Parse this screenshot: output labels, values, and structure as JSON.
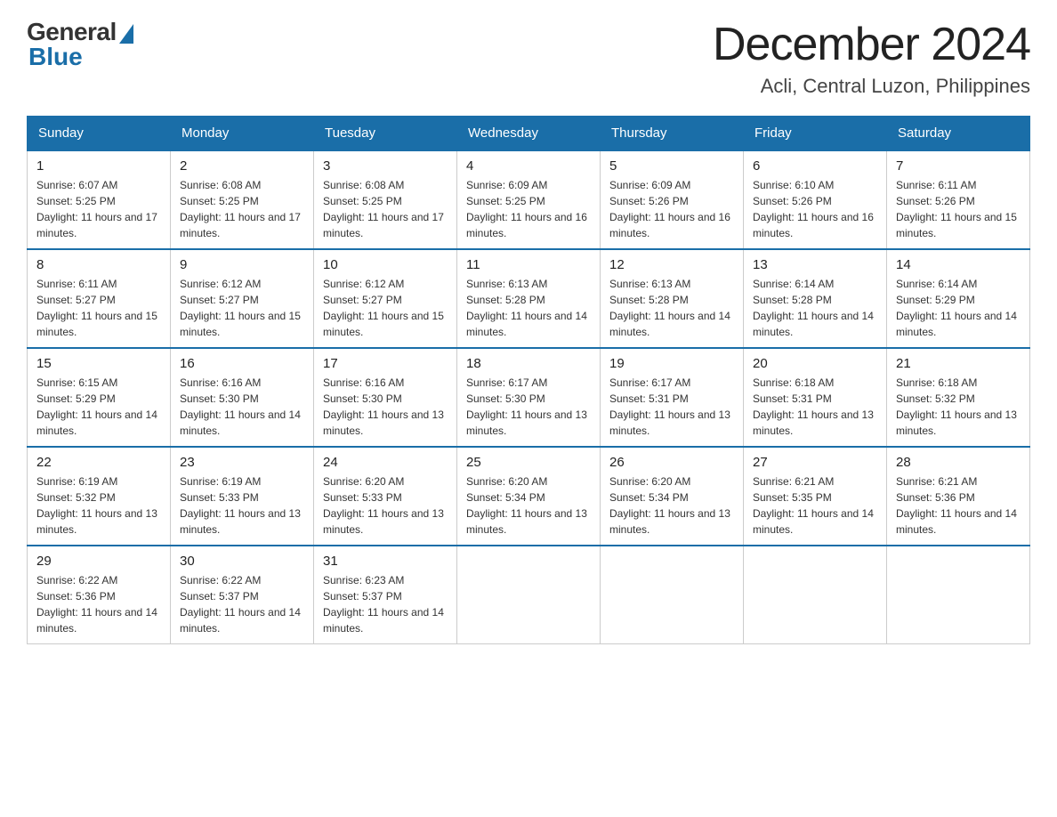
{
  "header": {
    "logo_general": "General",
    "logo_blue": "Blue",
    "month_title": "December 2024",
    "location": "Acli, Central Luzon, Philippines"
  },
  "days_of_week": [
    "Sunday",
    "Monday",
    "Tuesday",
    "Wednesday",
    "Thursday",
    "Friday",
    "Saturday"
  ],
  "weeks": [
    [
      {
        "day": "1",
        "sunrise": "6:07 AM",
        "sunset": "5:25 PM",
        "daylight": "11 hours and 17 minutes."
      },
      {
        "day": "2",
        "sunrise": "6:08 AM",
        "sunset": "5:25 PM",
        "daylight": "11 hours and 17 minutes."
      },
      {
        "day": "3",
        "sunrise": "6:08 AM",
        "sunset": "5:25 PM",
        "daylight": "11 hours and 17 minutes."
      },
      {
        "day": "4",
        "sunrise": "6:09 AM",
        "sunset": "5:25 PM",
        "daylight": "11 hours and 16 minutes."
      },
      {
        "day": "5",
        "sunrise": "6:09 AM",
        "sunset": "5:26 PM",
        "daylight": "11 hours and 16 minutes."
      },
      {
        "day": "6",
        "sunrise": "6:10 AM",
        "sunset": "5:26 PM",
        "daylight": "11 hours and 16 minutes."
      },
      {
        "day": "7",
        "sunrise": "6:11 AM",
        "sunset": "5:26 PM",
        "daylight": "11 hours and 15 minutes."
      }
    ],
    [
      {
        "day": "8",
        "sunrise": "6:11 AM",
        "sunset": "5:27 PM",
        "daylight": "11 hours and 15 minutes."
      },
      {
        "day": "9",
        "sunrise": "6:12 AM",
        "sunset": "5:27 PM",
        "daylight": "11 hours and 15 minutes."
      },
      {
        "day": "10",
        "sunrise": "6:12 AM",
        "sunset": "5:27 PM",
        "daylight": "11 hours and 15 minutes."
      },
      {
        "day": "11",
        "sunrise": "6:13 AM",
        "sunset": "5:28 PM",
        "daylight": "11 hours and 14 minutes."
      },
      {
        "day": "12",
        "sunrise": "6:13 AM",
        "sunset": "5:28 PM",
        "daylight": "11 hours and 14 minutes."
      },
      {
        "day": "13",
        "sunrise": "6:14 AM",
        "sunset": "5:28 PM",
        "daylight": "11 hours and 14 minutes."
      },
      {
        "day": "14",
        "sunrise": "6:14 AM",
        "sunset": "5:29 PM",
        "daylight": "11 hours and 14 minutes."
      }
    ],
    [
      {
        "day": "15",
        "sunrise": "6:15 AM",
        "sunset": "5:29 PM",
        "daylight": "11 hours and 14 minutes."
      },
      {
        "day": "16",
        "sunrise": "6:16 AM",
        "sunset": "5:30 PM",
        "daylight": "11 hours and 14 minutes."
      },
      {
        "day": "17",
        "sunrise": "6:16 AM",
        "sunset": "5:30 PM",
        "daylight": "11 hours and 13 minutes."
      },
      {
        "day": "18",
        "sunrise": "6:17 AM",
        "sunset": "5:30 PM",
        "daylight": "11 hours and 13 minutes."
      },
      {
        "day": "19",
        "sunrise": "6:17 AM",
        "sunset": "5:31 PM",
        "daylight": "11 hours and 13 minutes."
      },
      {
        "day": "20",
        "sunrise": "6:18 AM",
        "sunset": "5:31 PM",
        "daylight": "11 hours and 13 minutes."
      },
      {
        "day": "21",
        "sunrise": "6:18 AM",
        "sunset": "5:32 PM",
        "daylight": "11 hours and 13 minutes."
      }
    ],
    [
      {
        "day": "22",
        "sunrise": "6:19 AM",
        "sunset": "5:32 PM",
        "daylight": "11 hours and 13 minutes."
      },
      {
        "day": "23",
        "sunrise": "6:19 AM",
        "sunset": "5:33 PM",
        "daylight": "11 hours and 13 minutes."
      },
      {
        "day": "24",
        "sunrise": "6:20 AM",
        "sunset": "5:33 PM",
        "daylight": "11 hours and 13 minutes."
      },
      {
        "day": "25",
        "sunrise": "6:20 AM",
        "sunset": "5:34 PM",
        "daylight": "11 hours and 13 minutes."
      },
      {
        "day": "26",
        "sunrise": "6:20 AM",
        "sunset": "5:34 PM",
        "daylight": "11 hours and 13 minutes."
      },
      {
        "day": "27",
        "sunrise": "6:21 AM",
        "sunset": "5:35 PM",
        "daylight": "11 hours and 14 minutes."
      },
      {
        "day": "28",
        "sunrise": "6:21 AM",
        "sunset": "5:36 PM",
        "daylight": "11 hours and 14 minutes."
      }
    ],
    [
      {
        "day": "29",
        "sunrise": "6:22 AM",
        "sunset": "5:36 PM",
        "daylight": "11 hours and 14 minutes."
      },
      {
        "day": "30",
        "sunrise": "6:22 AM",
        "sunset": "5:37 PM",
        "daylight": "11 hours and 14 minutes."
      },
      {
        "day": "31",
        "sunrise": "6:23 AM",
        "sunset": "5:37 PM",
        "daylight": "11 hours and 14 minutes."
      },
      null,
      null,
      null,
      null
    ]
  ]
}
